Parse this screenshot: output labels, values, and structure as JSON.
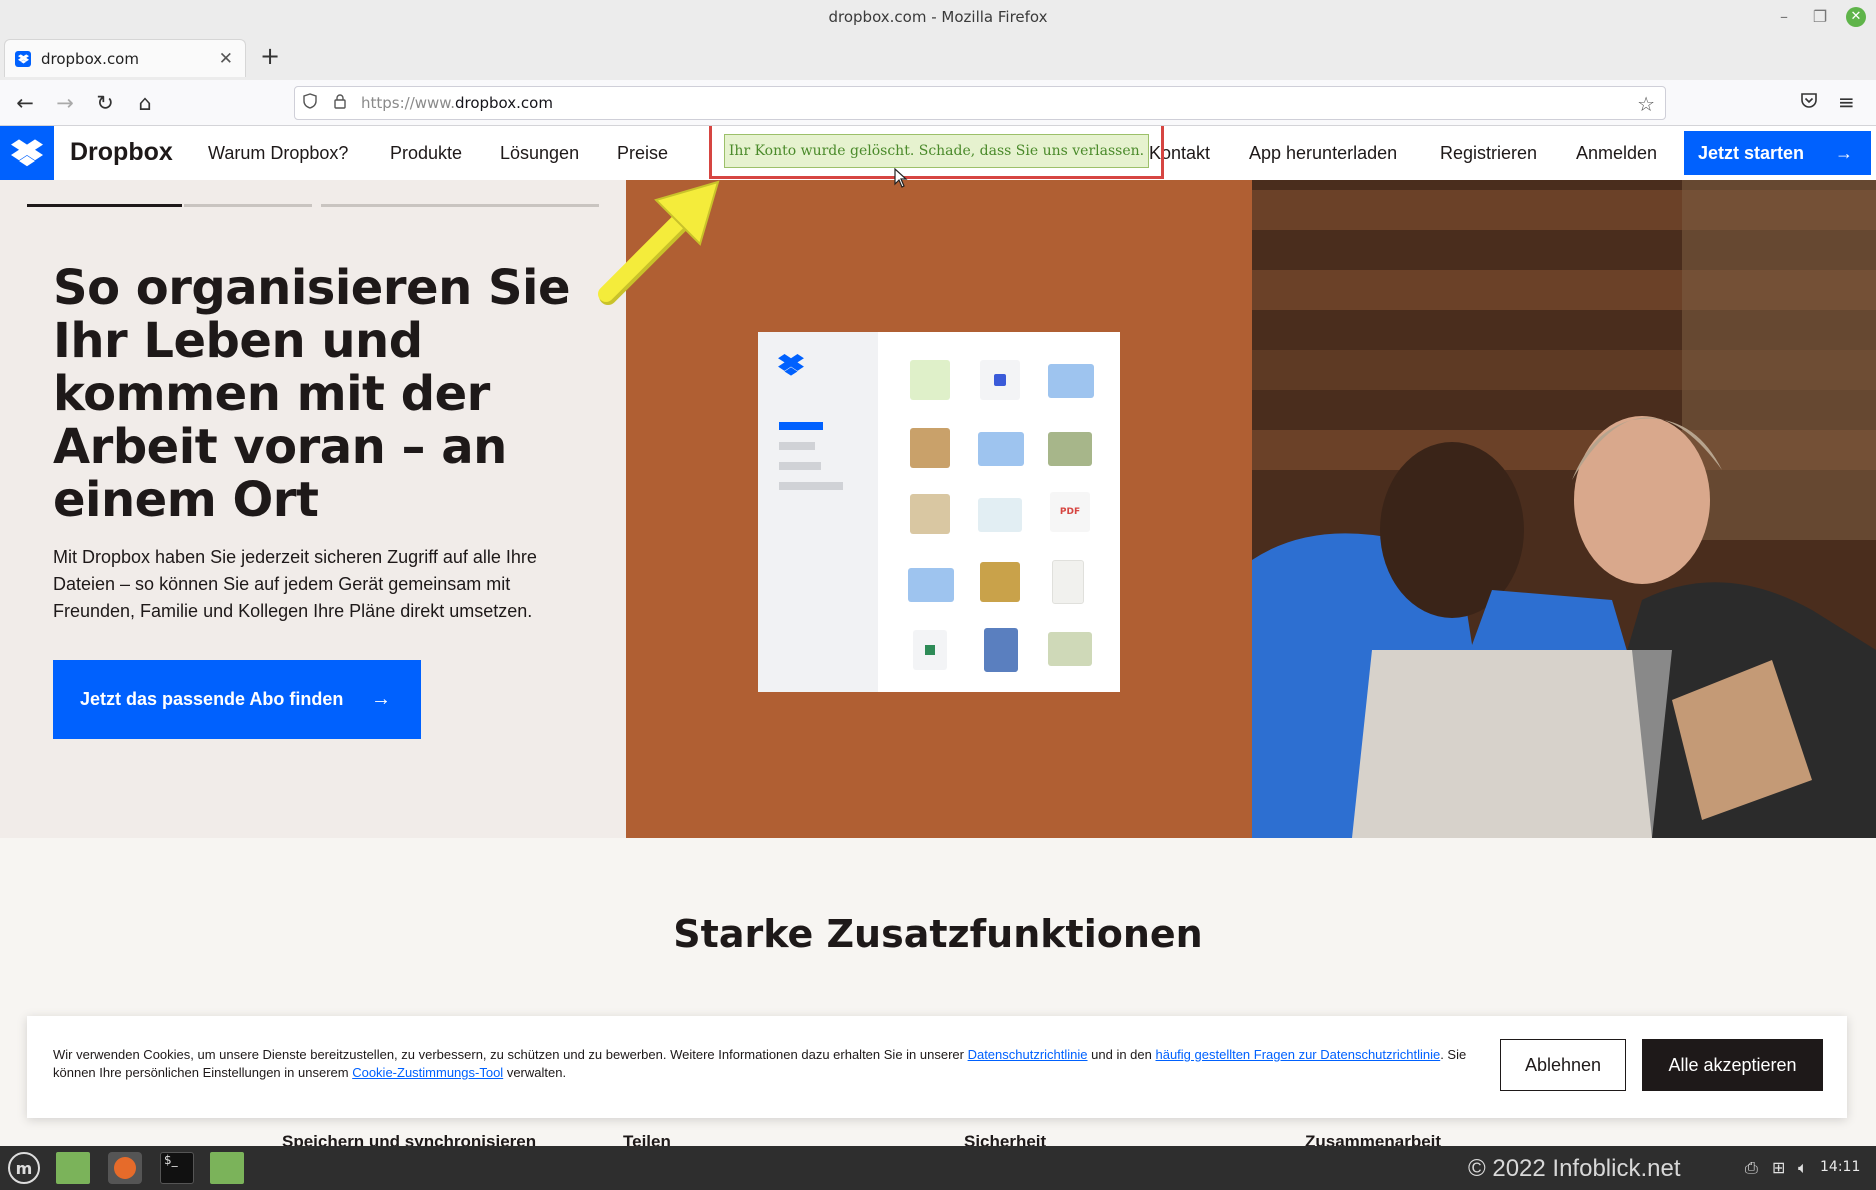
{
  "window": {
    "title": "dropbox.com - Mozilla Firefox"
  },
  "browser": {
    "tab_title": "dropbox.com",
    "url_protocol": "https://www.",
    "url_host": "dropbox.com"
  },
  "site": {
    "brand": "Dropbox",
    "menu": [
      "Warum Dropbox?",
      "Produkte",
      "Lösungen",
      "Preise",
      "Kontakt",
      "App herunterladen",
      "Registrieren",
      "Anmelden"
    ],
    "cta_top": "Jetzt starten",
    "notice": "Ihr Konto wurde gelöscht. Schade, dass Sie uns verlassen."
  },
  "hero": {
    "title": "So organisieren Sie Ihr Leben und kommen mit der Arbeit voran – an einem Ort",
    "text": "Mit Dropbox haben Sie jederzeit sicheren Zugriff auf alle Ihre Dateien – so können Sie auf jedem Gerät gemeinsam mit Freunden, Familie und Kollegen Ihre Pläne direkt umsetzen.",
    "cta": "Jetzt das passende Abo finden",
    "mock_pdf": "PDF"
  },
  "section": {
    "title": "Starke Zusatzfunktionen",
    "features": [
      "Speichern und synchronisieren",
      "Teilen",
      "Sicherheit",
      "Zusammenarbeit"
    ]
  },
  "cookie": {
    "text_1": "Wir verwenden Cookies, um unsere Dienste bereitzustellen, zu verbessern, zu schützen und zu bewerben. Weitere Informationen dazu erhalten Sie in unserer ",
    "link_privacy": "Datenschutzrichtlinie",
    "text_2": " und in den ",
    "link_faq": "häufig gestellten Fragen zur Datenschutzrichtlinie",
    "text_3": ". Sie können Ihre persönlichen Einstellungen in unserem ",
    "link_tool": "Cookie-Zustimmungs-Tool",
    "text_4": " verwalten.",
    "reject": "Ablehnen",
    "accept": "Alle akzeptieren"
  },
  "taskbar": {
    "watermark": "© 2022 Infoblick.net",
    "clock": "14:11"
  },
  "colors": {
    "brand_blue": "#0061fe",
    "hero_mid": "#b05f33",
    "notice_bg": "#e6f2cf",
    "highlight_red": "#d64541",
    "arrow_yellow": "#f4ec3b"
  },
  "icons": [
    "shield-icon",
    "lock-icon",
    "bookmark-star-icon",
    "pocket-icon",
    "app-menu-icon",
    "back-icon",
    "forward-icon",
    "reload-icon",
    "home-icon"
  ]
}
